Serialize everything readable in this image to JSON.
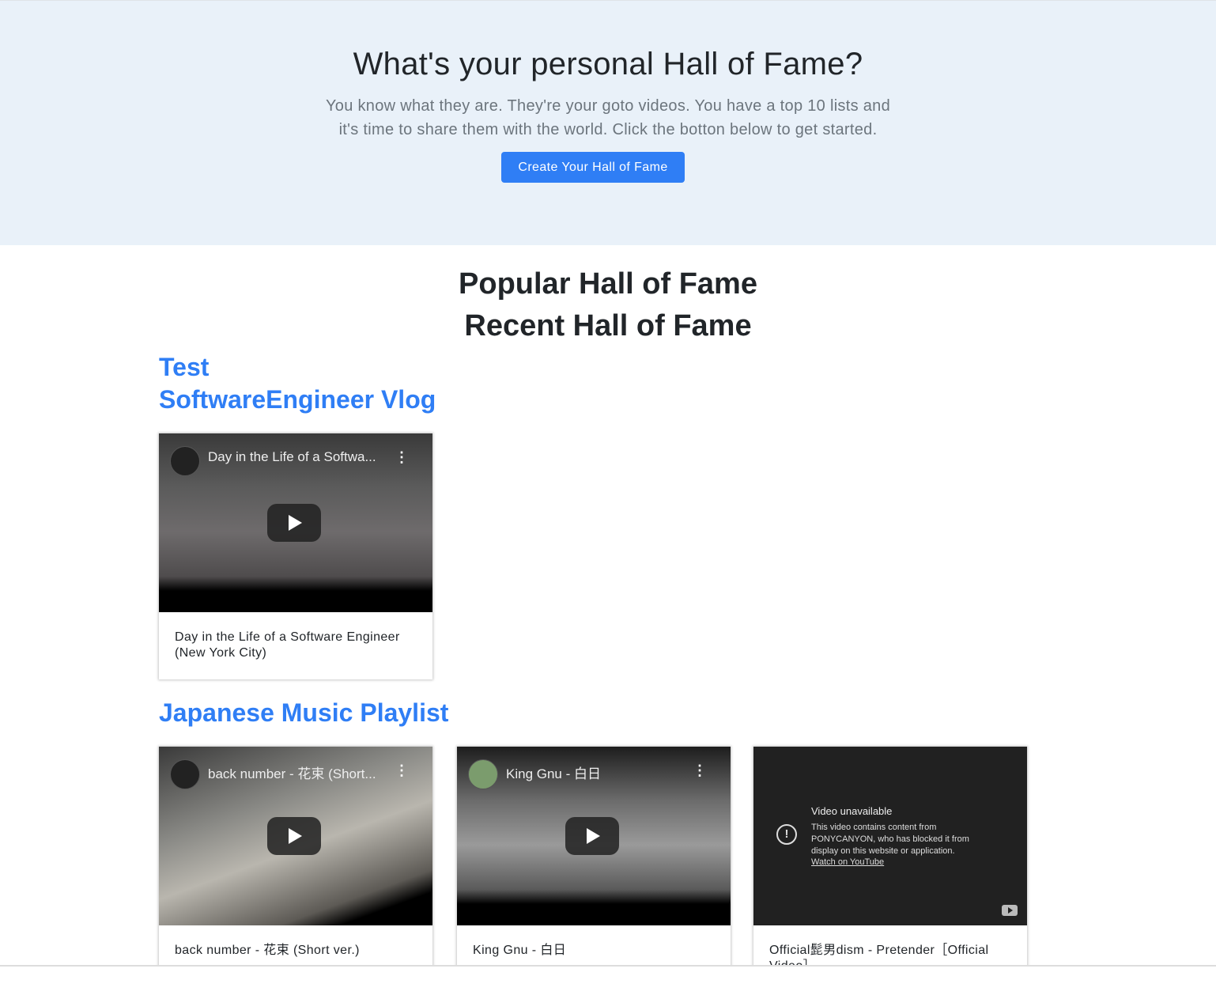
{
  "hero": {
    "title": "What's your personal Hall of Fame?",
    "lead_line1": "You know what they are. They're your goto videos. You have a top 10 lists and",
    "lead_line2": "it's time to share them with the world. Click the botton below to get started.",
    "cta_label": "Create Your Hall of Fame"
  },
  "sections": {
    "popular_title": "Popular Hall of Fame",
    "recent_title": "Recent Hall of Fame"
  },
  "lists": [
    {
      "title": "Test",
      "videos": []
    },
    {
      "title": "SoftwareEngineer Vlog",
      "videos": [
        {
          "embed_title": "Day in the Life of a Softwa...",
          "caption": "Day in the Life of a Software Engineer (New York City)"
        }
      ]
    },
    {
      "title": "Japanese Music Playlist",
      "videos": [
        {
          "embed_title": "back number - 花束 (Short...",
          "caption": "back number - 花束 (Short ver.)"
        },
        {
          "embed_title": "King Gnu - 白日",
          "caption": "King Gnu - 白日"
        },
        {
          "unavailable_title": "Video unavailable",
          "unavailable_body": "This video contains content from PONYCANYON, who has blocked it from display on this website or application.",
          "unavailable_link": "Watch on YouTube",
          "caption": "Official髭男dism - Pretender［Official Video］"
        }
      ]
    }
  ]
}
